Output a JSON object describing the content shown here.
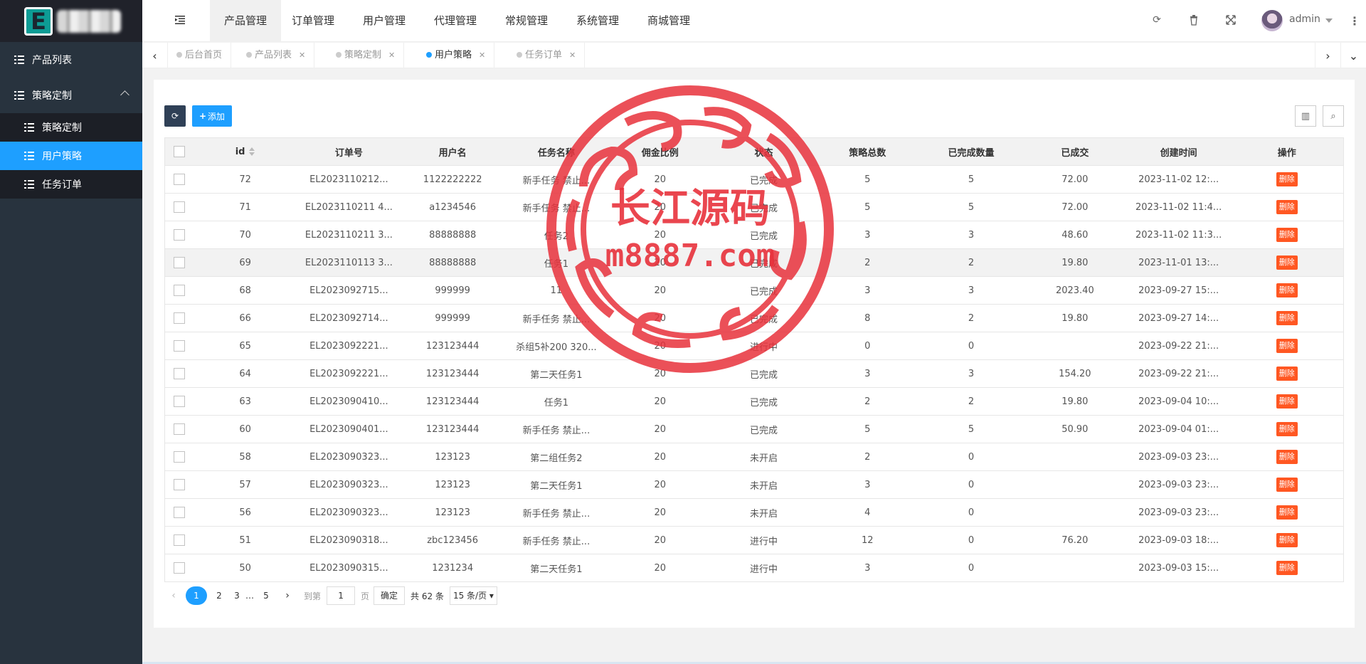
{
  "app": {
    "logo_letter": "E"
  },
  "sidebar": {
    "items": [
      {
        "label": "产品列表",
        "icon": "list-icon"
      },
      {
        "label": "策略定制",
        "icon": "list-icon",
        "expanded": true
      }
    ],
    "subitems": [
      {
        "label": "策略定制",
        "icon": "list-icon"
      },
      {
        "label": "用户策略",
        "icon": "list-icon",
        "active": true
      },
      {
        "label": "任务订单",
        "icon": "list-icon"
      }
    ]
  },
  "topbar": {
    "menu": [
      "产品管理",
      "订单管理",
      "用户管理",
      "代理管理",
      "常规管理",
      "系统管理",
      "商城管理"
    ],
    "active_menu": "产品管理",
    "icons": [
      "refresh-icon",
      "trash-icon",
      "fullscreen-icon"
    ],
    "user": "admin"
  },
  "tabs": [
    {
      "label": "后台首页",
      "closable": false
    },
    {
      "label": "产品列表",
      "closable": true
    },
    {
      "label": "策略定制",
      "closable": true
    },
    {
      "label": "用户策略",
      "closable": true,
      "active": true
    },
    {
      "label": "任务订单",
      "closable": true
    }
  ],
  "toolbar": {
    "add_label": "添加"
  },
  "table": {
    "headers": [
      "id",
      "订单号",
      "用户名",
      "任务名称",
      "佣金比例",
      "状态",
      "策略总数",
      "已完成数量",
      "已成交",
      "创建时间",
      "操作"
    ],
    "delete_label": "删除",
    "rows": [
      [
        "72",
        "EL2023110212...",
        "1122222222",
        "新手任务 禁止...",
        "20",
        "已完成",
        "5",
        "5",
        "72.00",
        "2023-11-02 12:..."
      ],
      [
        "71",
        "EL2023110211 4...",
        "a1234546",
        "新手任务 禁止...",
        "20",
        "已完成",
        "5",
        "5",
        "72.00",
        "2023-11-02 11:4..."
      ],
      [
        "70",
        "EL2023110211 3...",
        "88888888",
        "任务2",
        "20",
        "已完成",
        "3",
        "3",
        "48.60",
        "2023-11-02 11:3..."
      ],
      [
        "69",
        "EL2023110113 3...",
        "88888888",
        "任务1",
        "20",
        "已完成",
        "2",
        "2",
        "19.80",
        "2023-11-01 13:..."
      ],
      [
        "68",
        "EL2023092715...",
        "999999",
        "11",
        "20",
        "已完成",
        "3",
        "3",
        "2023.40",
        "2023-09-27 15:..."
      ],
      [
        "66",
        "EL2023092714...",
        "999999",
        "新手任务 禁止...",
        "20",
        "已完成",
        "8",
        "2",
        "19.80",
        "2023-09-27 14:..."
      ],
      [
        "65",
        "EL2023092221...",
        "123123444",
        "杀组5补200 320...",
        "20",
        "进行中",
        "0",
        "0",
        "",
        "2023-09-22 21:..."
      ],
      [
        "64",
        "EL2023092221...",
        "123123444",
        "第二天任务1",
        "20",
        "已完成",
        "3",
        "3",
        "154.20",
        "2023-09-22 21:..."
      ],
      [
        "63",
        "EL2023090410...",
        "123123444",
        "任务1",
        "20",
        "已完成",
        "2",
        "2",
        "19.80",
        "2023-09-04 10:..."
      ],
      [
        "60",
        "EL2023090401...",
        "123123444",
        "新手任务 禁止...",
        "20",
        "已完成",
        "5",
        "5",
        "50.90",
        "2023-09-04 01:..."
      ],
      [
        "58",
        "EL2023090323...",
        "123123",
        "第二组任务2",
        "20",
        "未开启",
        "2",
        "0",
        "",
        "2023-09-03 23:..."
      ],
      [
        "57",
        "EL2023090323...",
        "123123",
        "第二天任务1",
        "20",
        "未开启",
        "3",
        "0",
        "",
        "2023-09-03 23:..."
      ],
      [
        "56",
        "EL2023090323...",
        "123123",
        "新手任务 禁止...",
        "20",
        "未开启",
        "4",
        "0",
        "",
        "2023-09-03 23:..."
      ],
      [
        "51",
        "EL2023090318...",
        "zbc123456",
        "新手任务 禁止...",
        "20",
        "进行中",
        "12",
        "0",
        "76.20",
        "2023-09-03 18:..."
      ],
      [
        "50",
        "EL2023090315...",
        "1231234",
        "第二天任务1",
        "20",
        "进行中",
        "3",
        "0",
        "",
        "2023-09-03 15:..."
      ]
    ]
  },
  "pagination": {
    "pages": [
      "1",
      "2",
      "3",
      "…",
      "5"
    ],
    "current": "1",
    "goto_prefix": "到第",
    "goto_value": "1",
    "goto_suffix": "页",
    "confirm": "确定",
    "total": "共 62 条",
    "per_page": "15 条/页"
  },
  "watermark": {
    "line1": "长江源码",
    "line2": "m8887.com",
    "color": "#e8323c"
  }
}
